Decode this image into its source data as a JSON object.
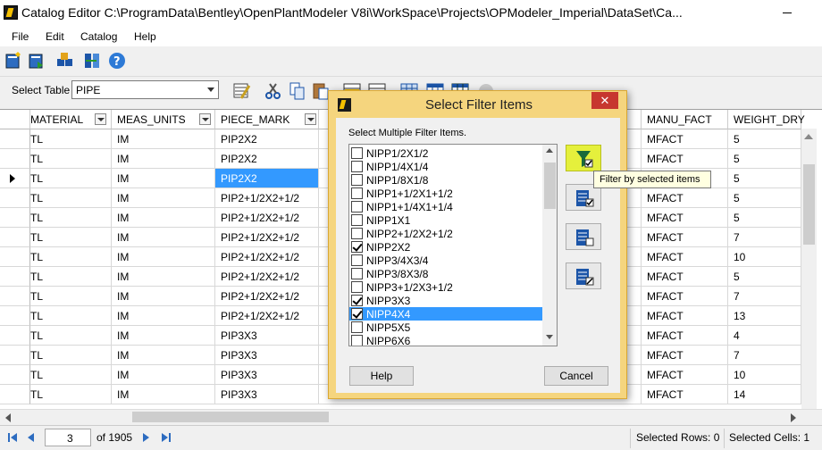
{
  "window": {
    "title": "Catalog Editor C:\\ProgramData\\Bentley\\OpenPlantModeler V8i\\WorkSpace\\Projects\\OPModeler_Imperial\\DataSet\\Ca..."
  },
  "menu": [
    "File",
    "Edit",
    "Catalog",
    "Help"
  ],
  "toolbar": {
    "select_table_label": "Select Table",
    "select_table_value": "PIPE"
  },
  "grid": {
    "columns": [
      "MATERIAL",
      "MEAS_UNITS",
      "PIECE_MARK",
      "MANU_FACT",
      "WEIGHT_DRY"
    ],
    "rows": [
      [
        "TL",
        "IM",
        "PIP2X2",
        "MFACT",
        "5"
      ],
      [
        "TL",
        "IM",
        "PIP2X2",
        "MFACT",
        "5"
      ],
      [
        "TL",
        "IM",
        "PIP2X2",
        "MFACT",
        "5"
      ],
      [
        "TL",
        "IM",
        "PIP2+1/2X2+1/2",
        "MFACT",
        "5"
      ],
      [
        "TL",
        "IM",
        "PIP2+1/2X2+1/2",
        "MFACT",
        "5"
      ],
      [
        "TL",
        "IM",
        "PIP2+1/2X2+1/2",
        "MFACT",
        "7"
      ],
      [
        "TL",
        "IM",
        "PIP2+1/2X2+1/2",
        "MFACT",
        "10"
      ],
      [
        "TL",
        "IM",
        "PIP2+1/2X2+1/2",
        "MFACT",
        "5"
      ],
      [
        "TL",
        "IM",
        "PIP2+1/2X2+1/2",
        "MFACT",
        "7"
      ],
      [
        "TL",
        "IM",
        "PIP2+1/2X2+1/2",
        "MFACT",
        "13"
      ],
      [
        "TL",
        "IM",
        "PIP3X3",
        "MFACT",
        "4"
      ],
      [
        "TL",
        "IM",
        "PIP3X3",
        "MFACT",
        "7"
      ],
      [
        "TL",
        "IM",
        "PIP3X3",
        "MFACT",
        "10"
      ],
      [
        "TL",
        "IM",
        "PIP3X3",
        "MFACT",
        "14"
      ]
    ],
    "selected_row": 2
  },
  "status": {
    "current_record": "3",
    "of_label": "of 1905",
    "selected_rows": "Selected Rows:  0",
    "selected_cells": "Selected Cells:  1"
  },
  "dialog": {
    "title": "Select Filter Items",
    "close_glyph": "✕",
    "instruction": "Select Multiple Filter Items.",
    "items": [
      {
        "label": "NIPP1/2X1/2",
        "checked": false
      },
      {
        "label": "NIPP1/4X1/4",
        "checked": false
      },
      {
        "label": "NIPP1/8X1/8",
        "checked": false
      },
      {
        "label": "NIPP1+1/2X1+1/2",
        "checked": false
      },
      {
        "label": "NIPP1+1/4X1+1/4",
        "checked": false
      },
      {
        "label": "NIPP1X1",
        "checked": false
      },
      {
        "label": "NIPP2+1/2X2+1/2",
        "checked": false
      },
      {
        "label": "NIPP2X2",
        "checked": true
      },
      {
        "label": "NIPP3/4X3/4",
        "checked": false
      },
      {
        "label": "NIPP3/8X3/8",
        "checked": false
      },
      {
        "label": "NIPP3+1/2X3+1/2",
        "checked": false
      },
      {
        "label": "NIPP3X3",
        "checked": true
      },
      {
        "label": "NIPP4X4",
        "checked": true
      },
      {
        "label": "NIPP5X5",
        "checked": false
      },
      {
        "label": "NIPP6X6",
        "checked": false
      }
    ],
    "highlighted_index": 12,
    "help_label": "Help",
    "cancel_label": "Cancel"
  },
  "tooltip": "Filter by selected items"
}
